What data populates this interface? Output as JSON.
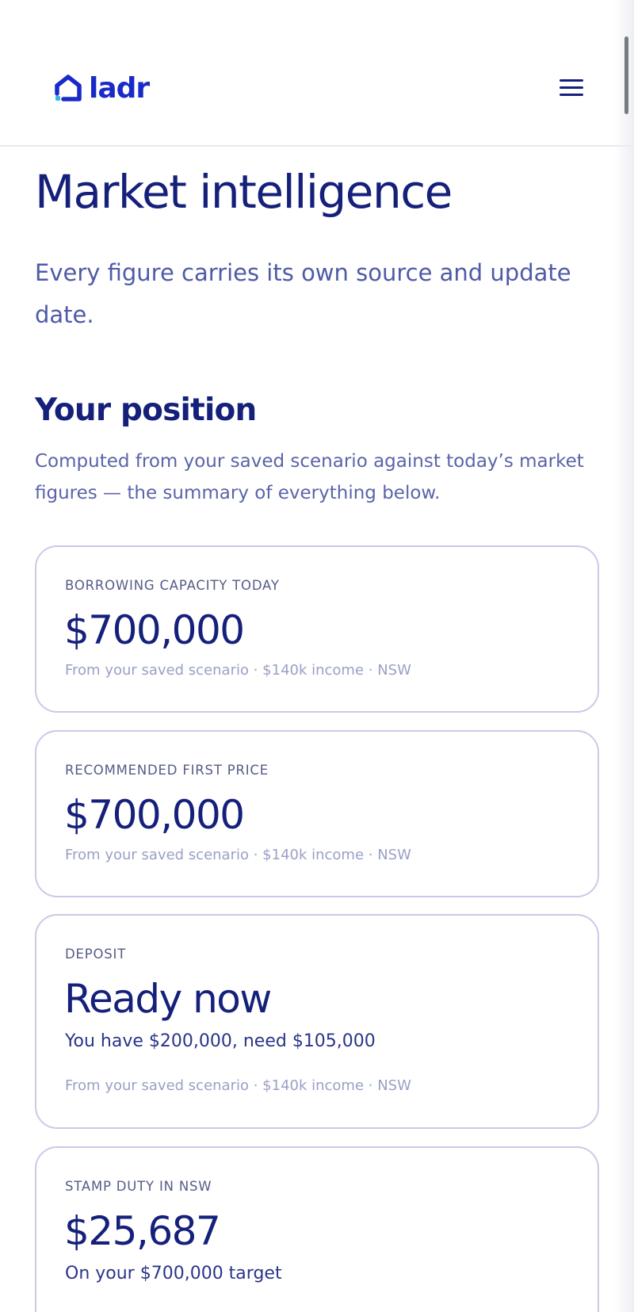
{
  "brand": {
    "name": "ladr",
    "color": "#1a2ac8"
  },
  "header": {
    "menu_icon": "hamburger-menu-icon"
  },
  "hero": {
    "title": "Market intelligence",
    "subtitle": "Every figure carries its own source and update date."
  },
  "position": {
    "title": "Your position",
    "description": "Computed from your saved scenario against today’s market figures — the summary of everything below."
  },
  "cards": [
    {
      "label": "BORROWING CAPACITY TODAY",
      "value": "$700,000",
      "source": "From your saved scenario · $140k income · NSW"
    },
    {
      "label": "RECOMMENDED FIRST PRICE",
      "value": "$700,000",
      "source": "From your saved scenario · $140k income · NSW"
    },
    {
      "label": "DEPOSIT",
      "value": "Ready now",
      "detail": "You have $200,000, need $105,000",
      "source": "From your saved scenario · $140k income · NSW"
    },
    {
      "label": "STAMP DUTY IN NSW",
      "value": "$25,687",
      "detail": "On your $700,000 target"
    }
  ],
  "colors": {
    "primary_text": "#15207a",
    "secondary_text": "#4f5aa8",
    "card_border": "#c7cbe8",
    "muted": "#9aa0c6"
  }
}
